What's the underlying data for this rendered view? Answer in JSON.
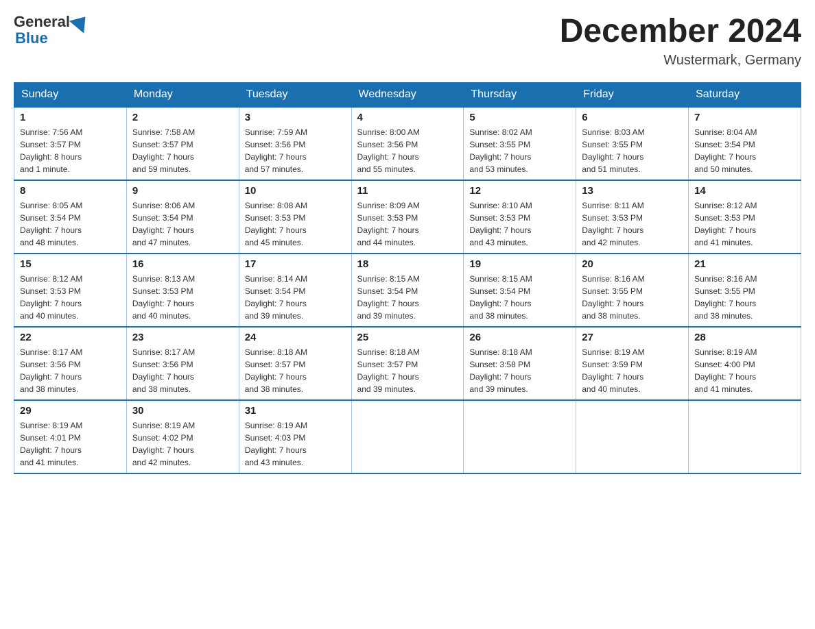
{
  "header": {
    "logo_general": "General",
    "logo_blue": "Blue",
    "month_year": "December 2024",
    "location": "Wustermark, Germany"
  },
  "days_of_week": [
    "Sunday",
    "Monday",
    "Tuesday",
    "Wednesday",
    "Thursday",
    "Friday",
    "Saturday"
  ],
  "weeks": [
    [
      {
        "day": "1",
        "info": "Sunrise: 7:56 AM\nSunset: 3:57 PM\nDaylight: 8 hours\nand 1 minute."
      },
      {
        "day": "2",
        "info": "Sunrise: 7:58 AM\nSunset: 3:57 PM\nDaylight: 7 hours\nand 59 minutes."
      },
      {
        "day": "3",
        "info": "Sunrise: 7:59 AM\nSunset: 3:56 PM\nDaylight: 7 hours\nand 57 minutes."
      },
      {
        "day": "4",
        "info": "Sunrise: 8:00 AM\nSunset: 3:56 PM\nDaylight: 7 hours\nand 55 minutes."
      },
      {
        "day": "5",
        "info": "Sunrise: 8:02 AM\nSunset: 3:55 PM\nDaylight: 7 hours\nand 53 minutes."
      },
      {
        "day": "6",
        "info": "Sunrise: 8:03 AM\nSunset: 3:55 PM\nDaylight: 7 hours\nand 51 minutes."
      },
      {
        "day": "7",
        "info": "Sunrise: 8:04 AM\nSunset: 3:54 PM\nDaylight: 7 hours\nand 50 minutes."
      }
    ],
    [
      {
        "day": "8",
        "info": "Sunrise: 8:05 AM\nSunset: 3:54 PM\nDaylight: 7 hours\nand 48 minutes."
      },
      {
        "day": "9",
        "info": "Sunrise: 8:06 AM\nSunset: 3:54 PM\nDaylight: 7 hours\nand 47 minutes."
      },
      {
        "day": "10",
        "info": "Sunrise: 8:08 AM\nSunset: 3:53 PM\nDaylight: 7 hours\nand 45 minutes."
      },
      {
        "day": "11",
        "info": "Sunrise: 8:09 AM\nSunset: 3:53 PM\nDaylight: 7 hours\nand 44 minutes."
      },
      {
        "day": "12",
        "info": "Sunrise: 8:10 AM\nSunset: 3:53 PM\nDaylight: 7 hours\nand 43 minutes."
      },
      {
        "day": "13",
        "info": "Sunrise: 8:11 AM\nSunset: 3:53 PM\nDaylight: 7 hours\nand 42 minutes."
      },
      {
        "day": "14",
        "info": "Sunrise: 8:12 AM\nSunset: 3:53 PM\nDaylight: 7 hours\nand 41 minutes."
      }
    ],
    [
      {
        "day": "15",
        "info": "Sunrise: 8:12 AM\nSunset: 3:53 PM\nDaylight: 7 hours\nand 40 minutes."
      },
      {
        "day": "16",
        "info": "Sunrise: 8:13 AM\nSunset: 3:53 PM\nDaylight: 7 hours\nand 40 minutes."
      },
      {
        "day": "17",
        "info": "Sunrise: 8:14 AM\nSunset: 3:54 PM\nDaylight: 7 hours\nand 39 minutes."
      },
      {
        "day": "18",
        "info": "Sunrise: 8:15 AM\nSunset: 3:54 PM\nDaylight: 7 hours\nand 39 minutes."
      },
      {
        "day": "19",
        "info": "Sunrise: 8:15 AM\nSunset: 3:54 PM\nDaylight: 7 hours\nand 38 minutes."
      },
      {
        "day": "20",
        "info": "Sunrise: 8:16 AM\nSunset: 3:55 PM\nDaylight: 7 hours\nand 38 minutes."
      },
      {
        "day": "21",
        "info": "Sunrise: 8:16 AM\nSunset: 3:55 PM\nDaylight: 7 hours\nand 38 minutes."
      }
    ],
    [
      {
        "day": "22",
        "info": "Sunrise: 8:17 AM\nSunset: 3:56 PM\nDaylight: 7 hours\nand 38 minutes."
      },
      {
        "day": "23",
        "info": "Sunrise: 8:17 AM\nSunset: 3:56 PM\nDaylight: 7 hours\nand 38 minutes."
      },
      {
        "day": "24",
        "info": "Sunrise: 8:18 AM\nSunset: 3:57 PM\nDaylight: 7 hours\nand 38 minutes."
      },
      {
        "day": "25",
        "info": "Sunrise: 8:18 AM\nSunset: 3:57 PM\nDaylight: 7 hours\nand 39 minutes."
      },
      {
        "day": "26",
        "info": "Sunrise: 8:18 AM\nSunset: 3:58 PM\nDaylight: 7 hours\nand 39 minutes."
      },
      {
        "day": "27",
        "info": "Sunrise: 8:19 AM\nSunset: 3:59 PM\nDaylight: 7 hours\nand 40 minutes."
      },
      {
        "day": "28",
        "info": "Sunrise: 8:19 AM\nSunset: 4:00 PM\nDaylight: 7 hours\nand 41 minutes."
      }
    ],
    [
      {
        "day": "29",
        "info": "Sunrise: 8:19 AM\nSunset: 4:01 PM\nDaylight: 7 hours\nand 41 minutes."
      },
      {
        "day": "30",
        "info": "Sunrise: 8:19 AM\nSunset: 4:02 PM\nDaylight: 7 hours\nand 42 minutes."
      },
      {
        "day": "31",
        "info": "Sunrise: 8:19 AM\nSunset: 4:03 PM\nDaylight: 7 hours\nand 43 minutes."
      },
      null,
      null,
      null,
      null
    ]
  ]
}
